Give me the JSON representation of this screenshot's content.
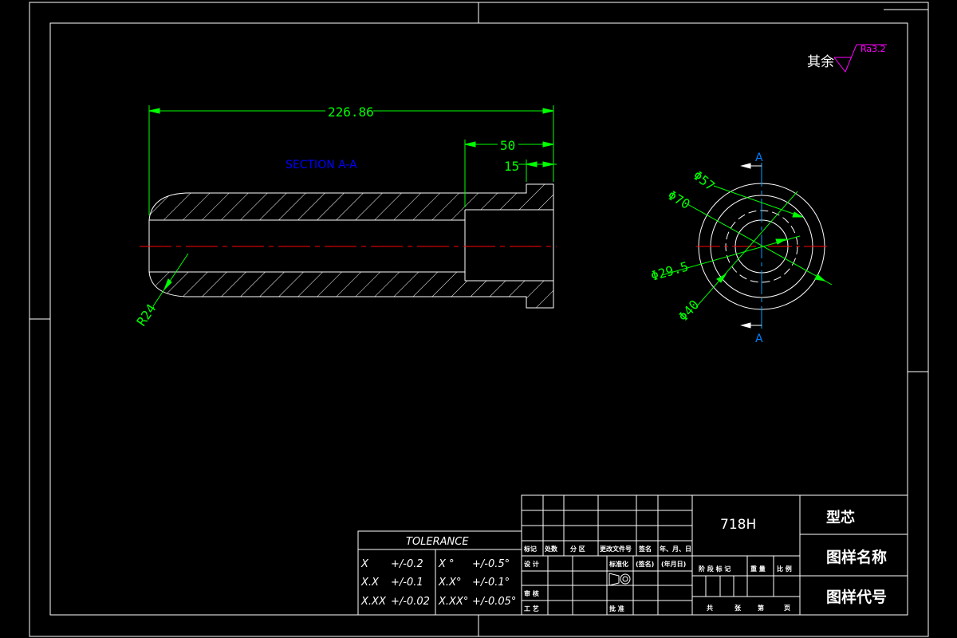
{
  "colors": {
    "background": "#000000",
    "frame": "#ffffff",
    "dimension": "#00ff00",
    "section_label": "#0000ff",
    "centerline": "#ff0000",
    "cut_plane": "#00a0ff",
    "roughness": "#ff00ff"
  },
  "roughness_note": {
    "prefix": "其余",
    "value": "Ra3.2"
  },
  "section_view": {
    "label": "SECTION A-A",
    "dim_overall": "226.86",
    "dim_counterbore_depth": "50",
    "dim_step": "15",
    "dim_radius": "R24"
  },
  "end_view": {
    "cut_label_top": "A",
    "cut_label_bottom": "A",
    "dim_57": "Φ57",
    "dim_70": "Φ70",
    "dim_29_5": "Φ29.5",
    "dim_40": "Φ40"
  },
  "tolerance": {
    "title": "TOLERANCE",
    "rows": [
      {
        "lin_key": "X",
        "lin_val": "+/-0.2",
        "ang_key": "X °",
        "ang_val": "+/-0.5°"
      },
      {
        "lin_key": "X.X",
        "lin_val": "+/-0.1",
        "ang_key": "X.X°",
        "ang_val": "+/-0.1°"
      },
      {
        "lin_key": "X.XX",
        "lin_val": "+/-0.02",
        "ang_key": "X.XX°",
        "ang_val": "+/-0.05°"
      }
    ]
  },
  "title_block": {
    "material": "718H",
    "part_name": "型芯",
    "drawing_name_label": "图样名称",
    "drawing_code_label": "图样代号",
    "rev_headers": [
      "标记",
      "处数",
      "分 区",
      "更改文件号",
      "签名",
      "年、月、日"
    ],
    "role_design": "设 计",
    "role_check": "审 核",
    "role_process": "工 艺",
    "role_approve": "批 准",
    "standardize": "标准化",
    "signature": "(签名)",
    "date": "(年月日)",
    "stage_headers": [
      "阶 段 标 记",
      "重 量",
      "比 例"
    ],
    "sheet_footer": [
      "共",
      "张",
      "第",
      "页"
    ]
  }
}
